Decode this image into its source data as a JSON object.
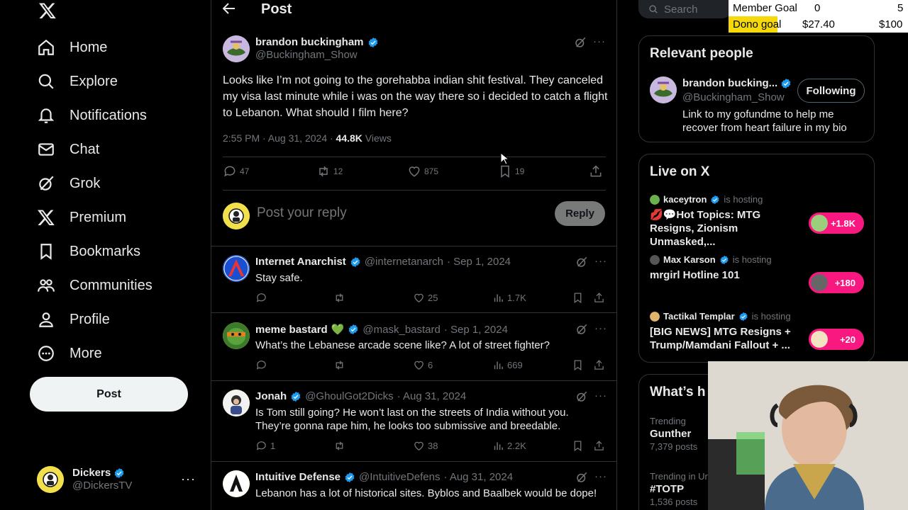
{
  "nav": {
    "items": [
      {
        "label": "Home",
        "icon": "home-icon"
      },
      {
        "label": "Explore",
        "icon": "search-icon"
      },
      {
        "label": "Notifications",
        "icon": "bell-icon"
      },
      {
        "label": "Chat",
        "icon": "mail-icon"
      },
      {
        "label": "Grok",
        "icon": "grok-icon"
      },
      {
        "label": "Premium",
        "icon": "x-logo-icon"
      },
      {
        "label": "Bookmarks",
        "icon": "bookmark-icon"
      },
      {
        "label": "Communities",
        "icon": "communities-icon"
      },
      {
        "label": "Profile",
        "icon": "profile-icon"
      },
      {
        "label": "More",
        "icon": "more-circle-icon"
      }
    ],
    "post_button": "Post"
  },
  "account": {
    "name": "Dickers",
    "handle": "@DickersTV"
  },
  "header": {
    "title": "Post"
  },
  "tweet": {
    "author": "brandon buckingham",
    "handle": "@Buckingham_Show",
    "text": "Looks like I’m not going to the gorehabba indian shit festival. They canceled my visa last minute while i was on the way there so i decided to catch a flight to Lebanon. What should I film here?",
    "time": "2:55 PM · Aug 31, 2024 · ",
    "views_count": "44.8K",
    "views_label": " Views",
    "replies": "47",
    "reposts": "12",
    "likes": "875",
    "bookmarks": "19"
  },
  "reply_box": {
    "placeholder": "Post your reply",
    "button": "Reply"
  },
  "replies": [
    {
      "name": "Internet Anarchist",
      "handle": "@internetanarch",
      "date": "· Sep 1, 2024",
      "text": "Stay safe.",
      "replies": "",
      "reposts": "",
      "likes": "25",
      "views": "1.7K",
      "heart": ""
    },
    {
      "name": "meme bastard",
      "handle": "@mask_bastard",
      "date": "· Sep 1, 2024",
      "text": "What’s the Lebanese arcade scene like? A lot of street fighter?",
      "replies": "",
      "reposts": "",
      "likes": "6",
      "views": "669",
      "heart": "💚"
    },
    {
      "name": "Jonah",
      "handle": "@GhoulGot2Dicks",
      "date": "· Aug 31, 2024",
      "text": "Is Tom still going? He won’t last on the streets of India without you. They’re gonna rape him, he looks too submissive and breedable.",
      "replies": "1",
      "reposts": "",
      "likes": "38",
      "views": "2.2K",
      "heart": ""
    },
    {
      "name": "Intuitive Defense",
      "handle": "@IntuitiveDefens",
      "date": "· Aug 31, 2024",
      "text": "Lebanon has a lot of historical sites. Byblos and Baalbek would be dope!",
      "replies": "",
      "reposts": "",
      "likes": "",
      "views": "",
      "heart": ""
    }
  ],
  "search": {
    "placeholder": "Search"
  },
  "relevant": {
    "title": "Relevant people",
    "name": "brandon bucking...",
    "handle": "@Buckingham_Show",
    "button": "Following",
    "bio": "Link to my gofundme to help me recover from heart failure in my bio"
  },
  "live": {
    "title": "Live on X",
    "hosting": "is hosting",
    "items": [
      {
        "host": "kaceytron",
        "topic": "💋💬Hot Topics: MTG Resigns, Zionism Unmasked,...",
        "count": "+1.8K"
      },
      {
        "host": "Max Karson",
        "topic": "mrgirl Hotline 101",
        "count": "+180"
      },
      {
        "host": "Tactikal Templar",
        "topic": "[BIG NEWS] MTG Resigns + Trump/Mamdani Fallout + ...",
        "count": "+20"
      }
    ]
  },
  "happening": {
    "title": "What’s h"
  },
  "trends": [
    {
      "category": "Trending",
      "title": "Gunther",
      "count": "7,379 posts"
    },
    {
      "category": "Trending in Un",
      "title": "#TOTP",
      "count": "1,536 posts"
    }
  ],
  "overlay": {
    "member_label": "Member Goal",
    "member_current": "0",
    "member_target": "5",
    "dono_label": "Dono goal",
    "dono_current": "$27.40",
    "dono_target": "$100",
    "dono_progress": 0.274
  },
  "colors": {
    "accent": "#1d9bf0",
    "live": "#f91880",
    "goal": "#f5d90a"
  }
}
